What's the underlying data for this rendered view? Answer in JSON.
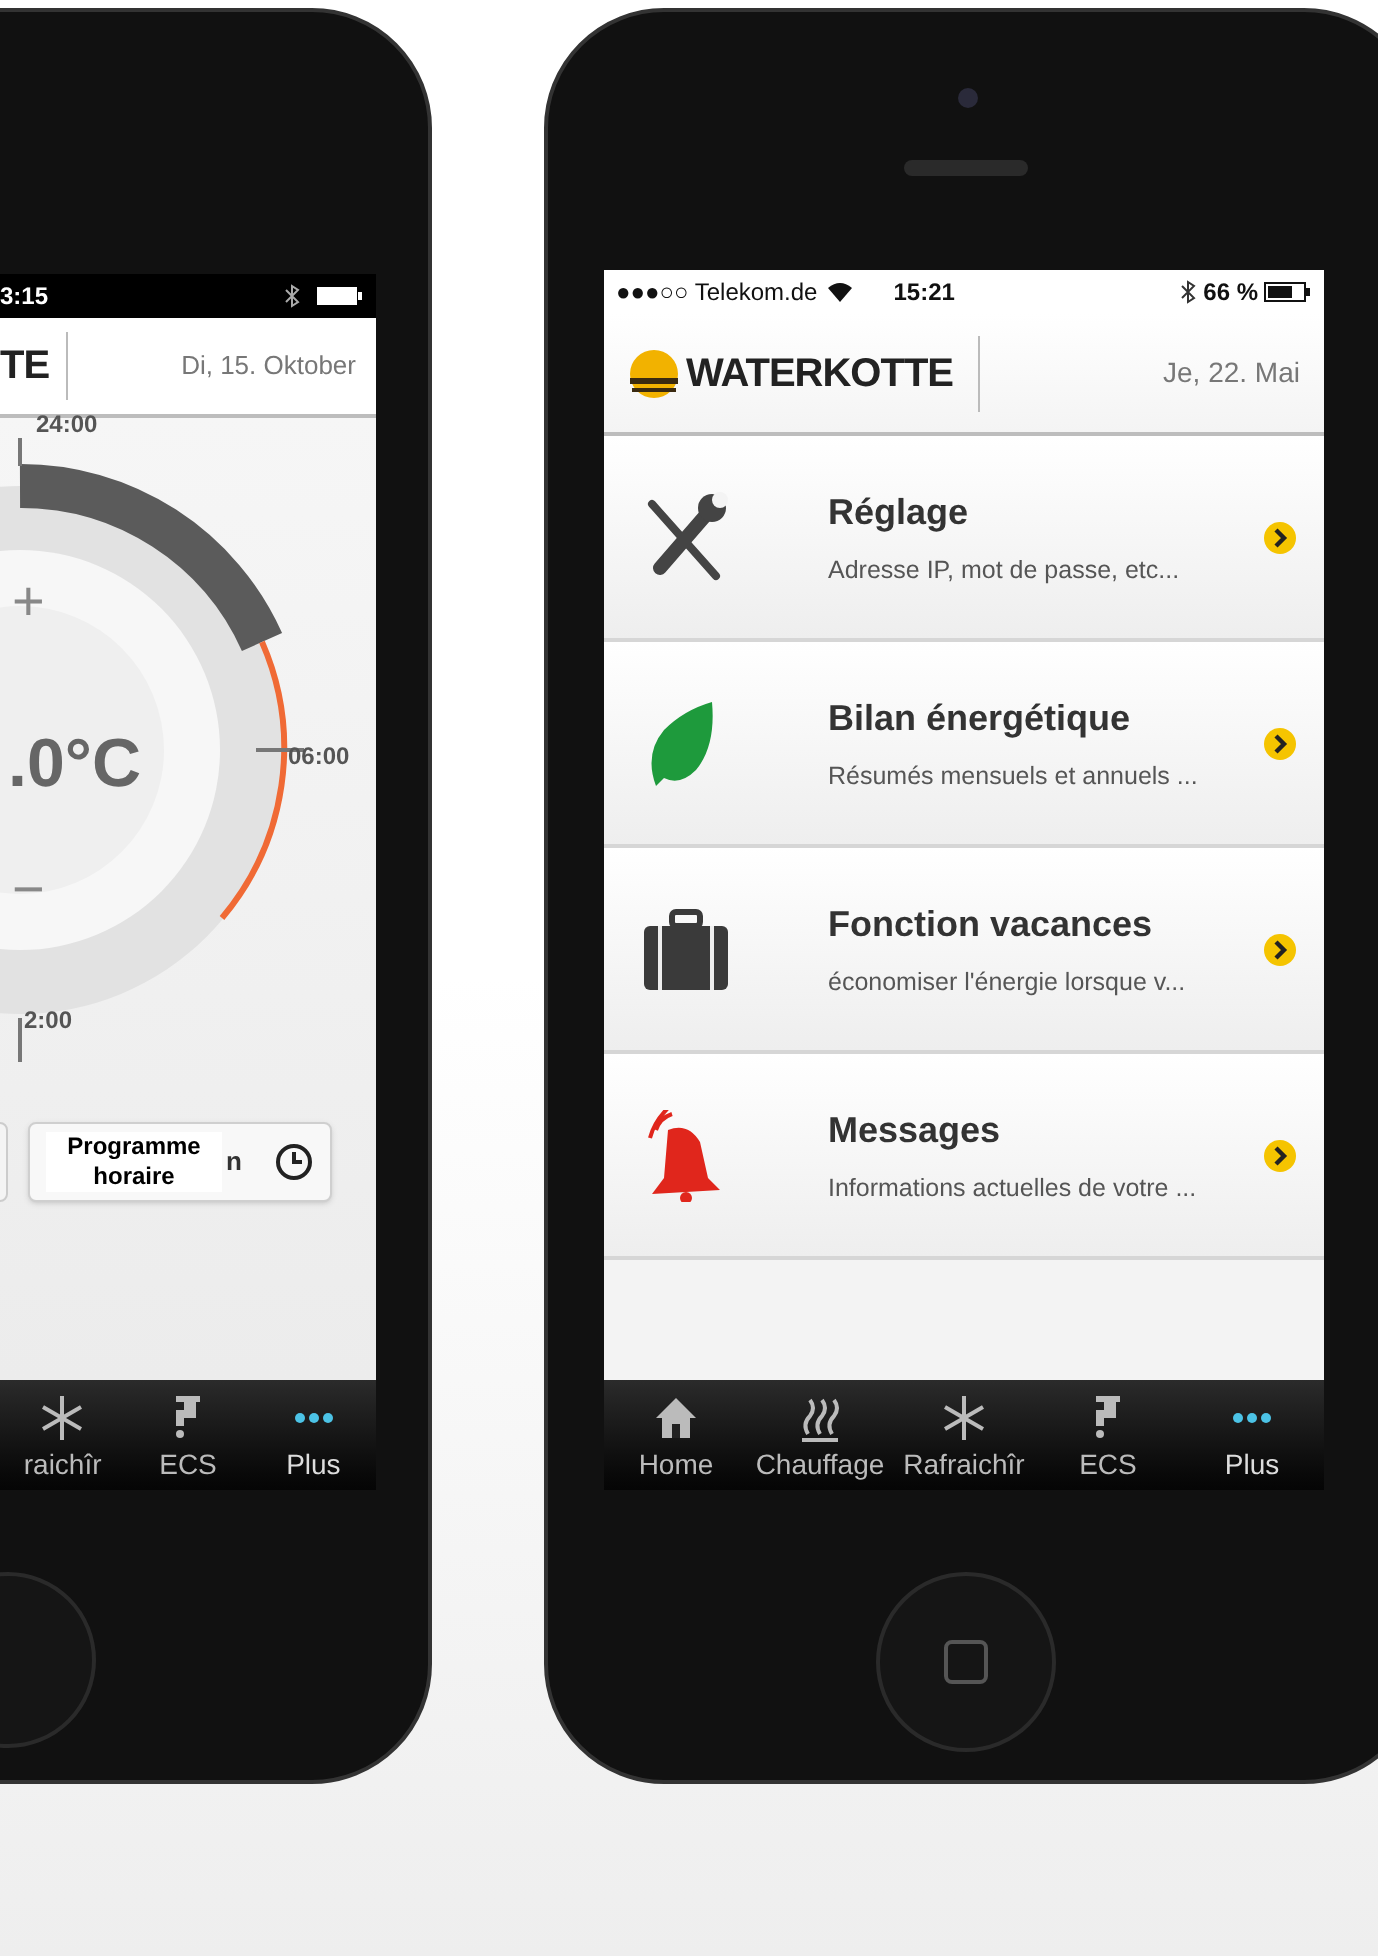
{
  "left_phone": {
    "status_bar": {
      "time": "3:15"
    },
    "header": {
      "logo_text": "TE",
      "date": "Di, 15. Oktober"
    },
    "dial": {
      "top_label": "24:00",
      "right_label": "06:00",
      "bottom_label": "2:00",
      "temperature": ".0°C",
      "plus": "+",
      "minus": "−"
    },
    "schedule_button": {
      "label": "Programme horaire",
      "trailing": "n"
    },
    "tabs": [
      {
        "kind": "snow",
        "label": "raichîr",
        "selected": false
      },
      {
        "kind": "tap",
        "label": "ECS",
        "selected": false
      },
      {
        "kind": "more",
        "label": "Plus",
        "selected": true
      }
    ]
  },
  "right_phone": {
    "status_bar": {
      "carrier": "●●●○○ Telekom.de",
      "time": "15:21",
      "battery": "66 %"
    },
    "header": {
      "logo": "WATERKOTTE",
      "date": "Je, 22. Mai"
    },
    "menu": [
      {
        "kind": "tools",
        "title": "Réglage",
        "subtitle": "Adresse IP, mot de passe, etc..."
      },
      {
        "kind": "leaf",
        "title": "Bilan énergétique",
        "subtitle": "Résumés mensuels et annuels ..."
      },
      {
        "kind": "suitcase",
        "title": "Fonction vacances",
        "subtitle": "économiser l'énergie lorsque v..."
      },
      {
        "kind": "bell",
        "title": "Messages",
        "subtitle": "Informations actuelles de votre ..."
      }
    ],
    "tabs": [
      {
        "kind": "home",
        "label": "Home",
        "selected": false
      },
      {
        "kind": "heat",
        "label": "Chauffage",
        "selected": false
      },
      {
        "kind": "snow",
        "label": "Rafraichîr",
        "selected": false
      },
      {
        "kind": "tap",
        "label": "ECS",
        "selected": false
      },
      {
        "kind": "more",
        "label": "Plus",
        "selected": true
      }
    ]
  }
}
